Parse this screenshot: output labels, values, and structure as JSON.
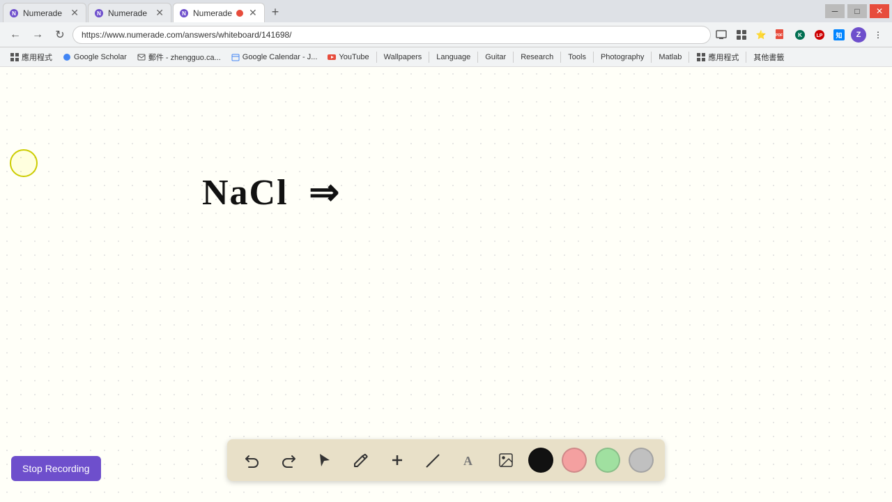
{
  "browser": {
    "tabs": [
      {
        "id": "tab1",
        "title": "Numerade",
        "active": false,
        "has_close": true
      },
      {
        "id": "tab2",
        "title": "Numerade",
        "active": false,
        "has_close": true
      },
      {
        "id": "tab3",
        "title": "Numerade",
        "active": true,
        "has_close": true
      }
    ],
    "address": "https://www.numerade.com/answers/whiteboard/141698/",
    "window_controls": [
      "minimize",
      "maximize",
      "close"
    ]
  },
  "bookmarks": [
    {
      "id": "bm1",
      "label": "應用程式",
      "icon": "grid"
    },
    {
      "id": "bm2",
      "label": "Google Scholar",
      "icon": "google"
    },
    {
      "id": "bm3",
      "label": "郵件 - zhengguo.ca...",
      "icon": "email"
    },
    {
      "id": "bm4",
      "label": "Google Calendar - J...",
      "icon": "calendar"
    },
    {
      "id": "bm5",
      "label": "YouTube",
      "icon": "youtube"
    },
    {
      "id": "bm6",
      "label": "Wallpapers",
      "icon": "bookmark"
    },
    {
      "id": "bm7",
      "label": "Language",
      "icon": "bookmark"
    },
    {
      "id": "bm8",
      "label": "Guitar",
      "icon": "bookmark"
    },
    {
      "id": "bm9",
      "label": "Research",
      "icon": "bookmark"
    },
    {
      "id": "bm10",
      "label": "Tools",
      "icon": "bookmark"
    },
    {
      "id": "bm11",
      "label": "Photography",
      "icon": "bookmark"
    },
    {
      "id": "bm12",
      "label": "Matlab",
      "icon": "bookmark"
    },
    {
      "id": "bm13",
      "label": "應用程式",
      "icon": "grid"
    },
    {
      "id": "bm14",
      "label": "其他書籤",
      "icon": "bookmark"
    }
  ],
  "whiteboard": {
    "content": "NaCl  =>",
    "cursor_visible": true
  },
  "toolbar": {
    "tools": [
      {
        "id": "undo",
        "label": "↺",
        "name": "undo-button"
      },
      {
        "id": "redo",
        "label": "↻",
        "name": "redo-button"
      },
      {
        "id": "select",
        "label": "↖",
        "name": "select-button"
      },
      {
        "id": "pen",
        "label": "✏",
        "name": "pen-button"
      },
      {
        "id": "add",
        "label": "+",
        "name": "add-button"
      },
      {
        "id": "eraser",
        "label": "/",
        "name": "eraser-button"
      },
      {
        "id": "text",
        "label": "A",
        "name": "text-button"
      },
      {
        "id": "image",
        "label": "🖼",
        "name": "image-button"
      }
    ],
    "colors": [
      {
        "id": "black",
        "hex": "#111111",
        "name": "color-black"
      },
      {
        "id": "pink",
        "hex": "#f4a0a0",
        "name": "color-pink"
      },
      {
        "id": "green",
        "hex": "#a0e0a0",
        "name": "color-green"
      },
      {
        "id": "gray",
        "hex": "#c0c0c0",
        "name": "color-gray"
      }
    ],
    "stop_recording_label": "Stop Recording"
  }
}
